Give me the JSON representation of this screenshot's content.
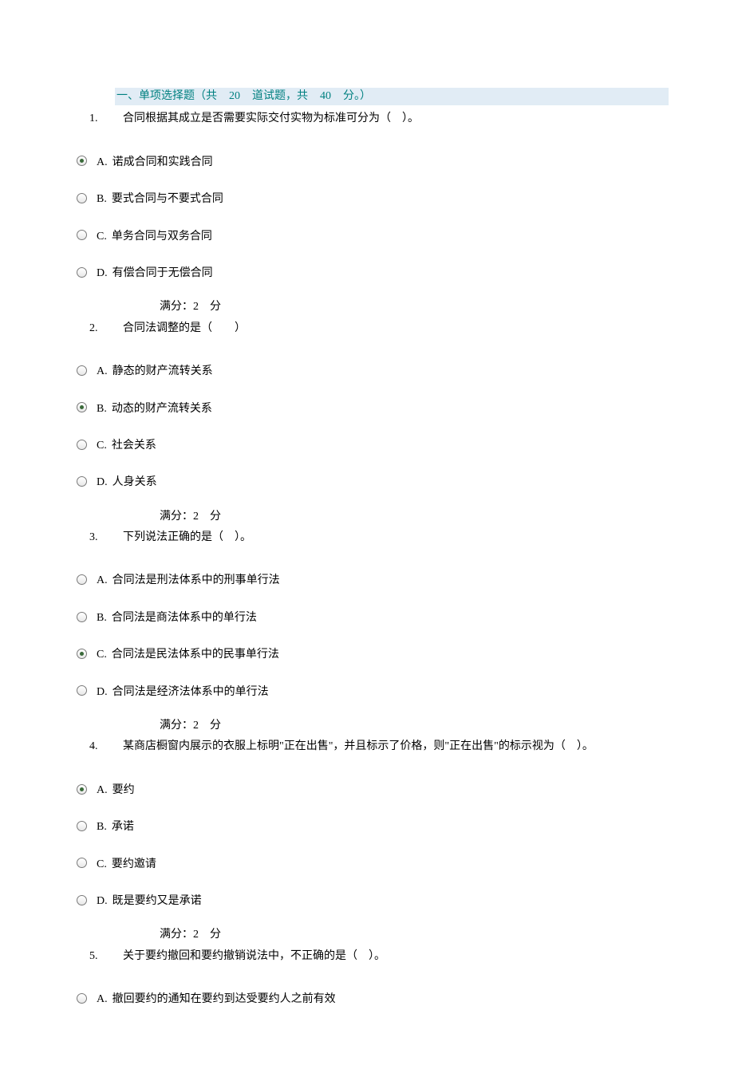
{
  "section_header": {
    "prefix": "一、单项选择题（共",
    "count": "20",
    "mid": "道试题，共",
    "points": "40",
    "suffix": "分。）"
  },
  "score": {
    "label_prefix": "满分：",
    "value": "2",
    "label_suffix": "分"
  },
  "questions": [
    {
      "num": "1.",
      "text": "合同根据其成立是否需要实际交付实物为标准可分为（　）。",
      "selected": 0,
      "options": [
        {
          "prefix": "A.",
          "text": "诺成合同和实践合同"
        },
        {
          "prefix": "B.",
          "text": "要式合同与不要式合同"
        },
        {
          "prefix": "C.",
          "text": "单务合同与双务合同"
        },
        {
          "prefix": "D.",
          "text": "有偿合同于无偿合同"
        }
      ]
    },
    {
      "num": "2.",
      "text": "合同法调整的是（　　）",
      "selected": 1,
      "options": [
        {
          "prefix": "A.",
          "text": "静态的财产流转关系"
        },
        {
          "prefix": "B.",
          "text": "动态的财产流转关系"
        },
        {
          "prefix": "C.",
          "text": "社会关系�ివ"
        },
        {
          "prefix": "D.",
          "text": "人身关系"
        }
      ]
    },
    {
      "num": "3.",
      "text": "下列说法正确的是（　）。",
      "selected": 2,
      "options": [
        {
          "prefix": "A.",
          "text": "合同法是刑法体系中的刑事单行法"
        },
        {
          "prefix": "B.",
          "text": "合同法是商法体系中的单行法"
        },
        {
          "prefix": "C.",
          "text": "合同法是民法体系中的民事单行法"
        },
        {
          "prefix": "D.",
          "text": "合同法是经济法体系中的单行法"
        }
      ]
    },
    {
      "num": "4.",
      "text": "某商店橱窗内展示的衣服上标明\"正在出售\"，并且标示了价格，则\"正在出售\"的标示视为（　）。",
      "selected": 0,
      "options": [
        {
          "prefix": "A.",
          "text": "要约"
        },
        {
          "prefix": "B.",
          "text": "承诺"
        },
        {
          "prefix": "C.",
          "text": "要约邀请"
        },
        {
          "prefix": "D.",
          "text": "既是要约又是承诺"
        }
      ]
    },
    {
      "num": "5.",
      "text": "关于要约撤回和要约撤销说法中，不正确的是（　）。",
      "selected": -1,
      "options": [
        {
          "prefix": "A.",
          "text": "撤回要约的通知在要约到达受要约人之前有效"
        }
      ]
    }
  ],
  "q2_fix": {
    "options": [
      {
        "prefix": "A.",
        "text": "静态的财产流转关系"
      },
      {
        "prefix": "B.",
        "text": "动态的财产流转关系"
      },
      {
        "prefix": "C.",
        "text": "社会关系"
      },
      {
        "prefix": "D.",
        "text": "人身关系"
      }
    ]
  }
}
